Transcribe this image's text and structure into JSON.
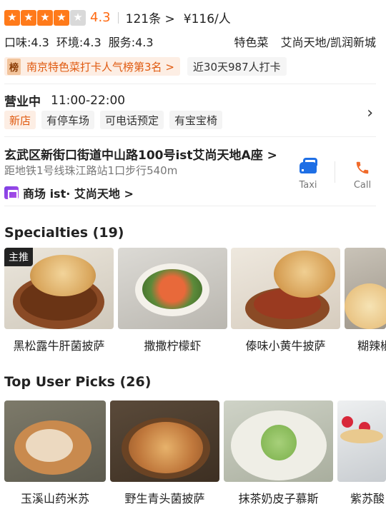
{
  "rating": {
    "score": "4.3",
    "stars": [
      "on",
      "on",
      "on",
      "on",
      "off"
    ],
    "reviews": "121条 >",
    "price": "¥116/人"
  },
  "sub_scores": {
    "taste": "口味:4.3",
    "env": "环境:4.3",
    "service": "服务:4.3",
    "category": "特色菜",
    "area": "艾尚天地/凯润新城"
  },
  "badges": {
    "rank_icon": "榜",
    "rank_text": "南京特色菜打卡人气榜第3名 >",
    "checkins": "近30天987人打卡"
  },
  "hours": {
    "status": "营业中",
    "time": "11:00-22:00"
  },
  "tags": [
    "新店",
    "有停车场",
    "可电话预定",
    "有宝宝椅"
  ],
  "address": {
    "text": "玄武区新街口街道中山路100号ist艾尚天地A座 >",
    "subway": "距地铁1号线珠江路站1口步行540m",
    "mall": "商场 ist· 艾尚天地 >"
  },
  "actions": {
    "taxi": "Taxi",
    "call": "Call"
  },
  "specialties": {
    "title": "Specialties (19)",
    "main_tag": "主推",
    "items": [
      "黑松露牛肝菌披萨",
      "撒撒柠檬虾",
      "傣味小黄牛披萨",
      "糊辣椒"
    ]
  },
  "top_picks": {
    "title": "Top User Picks (26)",
    "items": [
      "玉溪山药米苏",
      "野生青头菌披萨",
      "抹茶奶皮子慕斯",
      "紫苏酸"
    ]
  },
  "colors": {
    "accent": "#ff6a12",
    "taxi": "#1f6fe5",
    "call": "#f06a2a"
  },
  "icons": {
    "chevron": "chevron-right-icon",
    "taxi": "car-icon",
    "call": "phone-icon",
    "mall": "mall-icon"
  }
}
